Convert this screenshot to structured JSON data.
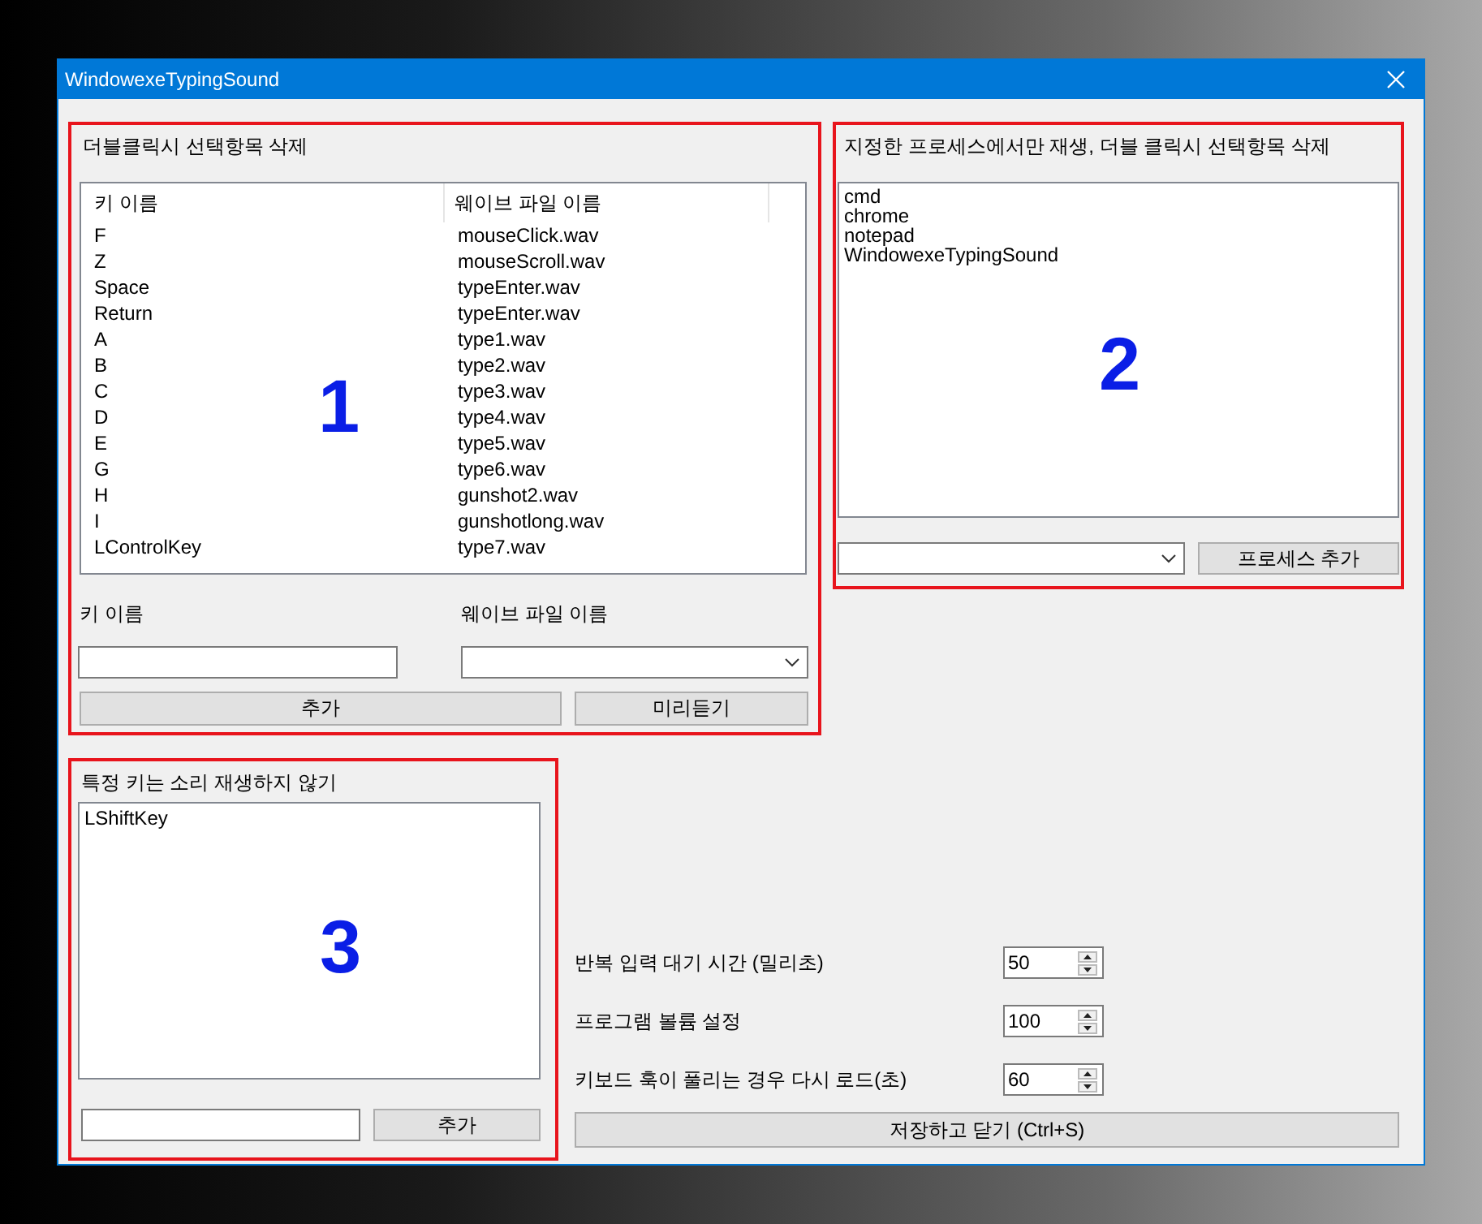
{
  "window": {
    "title": "WindowexeTypingSound"
  },
  "group_1": {
    "title": "더블클릭시 선택항목 삭제",
    "annotation": "1",
    "columns": [
      "키 이름",
      "웨이브 파일 이름"
    ],
    "rows": [
      [
        "F",
        "mouseClick.wav"
      ],
      [
        "Z",
        "mouseScroll.wav"
      ],
      [
        "Space",
        "typeEnter.wav"
      ],
      [
        "Return",
        "typeEnter.wav"
      ],
      [
        "A",
        "type1.wav"
      ],
      [
        "B",
        "type2.wav"
      ],
      [
        "C",
        "type3.wav"
      ],
      [
        "D",
        "type4.wav"
      ],
      [
        "E",
        "type5.wav"
      ],
      [
        "G",
        "type6.wav"
      ],
      [
        "H",
        "gunshot2.wav"
      ],
      [
        "I",
        "gunshotlong.wav"
      ],
      [
        "LControlKey",
        "type7.wav"
      ]
    ],
    "key_label": "키 이름",
    "wave_label": "웨이브 파일 이름",
    "add_button": "추가",
    "preview_button": "미리듣기"
  },
  "group_2": {
    "title": "지정한 프로세스에서만 재생, 더블 클릭시 선택항목 삭제",
    "annotation": "2",
    "items": [
      "cmd",
      "chrome",
      "notepad",
      "WindowexeTypingSound"
    ],
    "add_button": "프로세스 추가"
  },
  "group_3": {
    "title": "특정 키는 소리 재생하지 않기",
    "annotation": "3",
    "items": [
      "LShiftKey"
    ],
    "add_button": "추가"
  },
  "settings": [
    {
      "label": "반복 입력 대기 시간 (밀리초)",
      "value": "50"
    },
    {
      "label": "프로그램 볼륨 설정",
      "value": "100"
    },
    {
      "label": "키보드 훅이 풀리는 경우 다시 로드(초)",
      "value": "60"
    }
  ],
  "save_button": "저장하고 닫기 (Ctrl+S)"
}
